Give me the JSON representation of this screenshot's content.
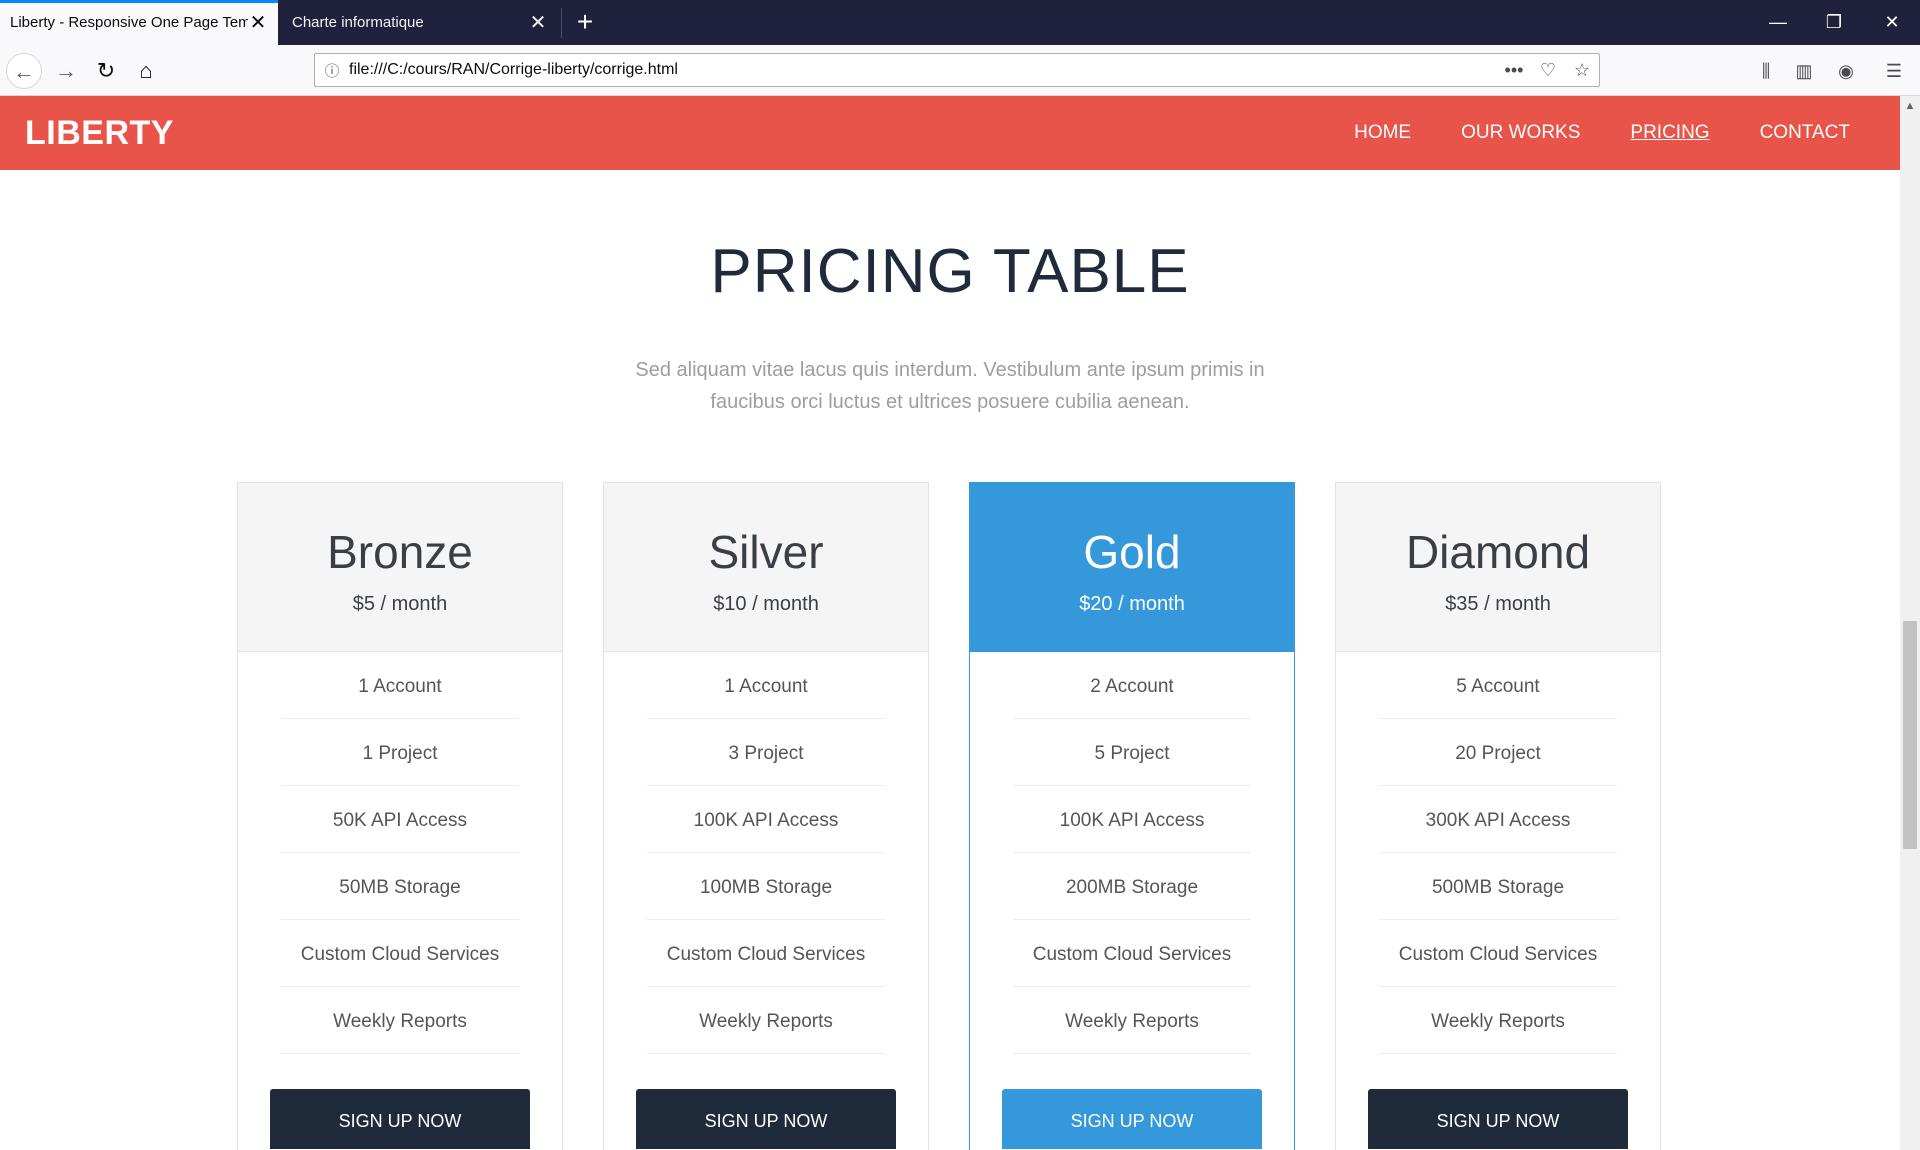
{
  "browser": {
    "tabs": [
      {
        "title": "Liberty - Responsive One Page Temp",
        "close": "✕"
      },
      {
        "title": "Charte informatique",
        "close": "✕"
      }
    ],
    "new_tab": "+",
    "window_controls": {
      "minimize": "—",
      "restore": "❐",
      "close": "✕"
    },
    "nav": {
      "back": "←",
      "forward": "→",
      "reload": "↻",
      "home": "⌂"
    },
    "url": "file:///C:/cours/RAN/Corrige-liberty/corrige.html",
    "url_icons": {
      "info": "ⓘ",
      "more": "•••",
      "pocket": "♡",
      "bookmark": "☆"
    },
    "toolbar_icons": {
      "library": "⫼",
      "sidebar": "▥",
      "account": "◉",
      "menu": "☰"
    }
  },
  "site": {
    "brand": "LIBERTY",
    "menu": [
      "HOME",
      "OUR WORKS",
      "PRICING",
      "CONTACT"
    ],
    "current_menu": "PRICING"
  },
  "pricing": {
    "title": "PRICING TABLE",
    "subtitle_line1": "Sed aliquam vitae lacus quis interdum. Vestibulum ante ipsum primis in",
    "subtitle_line2": "faucibus orci luctus et ultrices posuere cubilia aenean.",
    "plans": [
      {
        "name": "Bronze",
        "price": "$5 / month",
        "features": [
          "1 Account",
          "1 Project",
          "50K API Access",
          "50MB Storage",
          "Custom Cloud Services",
          "Weekly Reports"
        ],
        "cta": "SIGN UP NOW"
      },
      {
        "name": "Silver",
        "price": "$10 / month",
        "features": [
          "1 Account",
          "3 Project",
          "100K API Access",
          "100MB Storage",
          "Custom Cloud Services",
          "Weekly Reports"
        ],
        "cta": "SIGN UP NOW"
      },
      {
        "name": "Gold",
        "price": "$20 / month",
        "features": [
          "2 Account",
          "5 Project",
          "100K API Access",
          "200MB Storage",
          "Custom Cloud Services",
          "Weekly Reports"
        ],
        "cta": "SIGN UP NOW",
        "featured": true
      },
      {
        "name": "Diamond",
        "price": "$35 / month",
        "features": [
          "5 Account",
          "20 Project",
          "300K API Access",
          "500MB Storage",
          "Custom Cloud Services",
          "Weekly Reports"
        ],
        "cta": "SIGN UP NOW"
      }
    ]
  },
  "colors": {
    "header_red": "#e8544a",
    "featured_blue": "#3498db",
    "dark_button": "#1f2b3a"
  }
}
